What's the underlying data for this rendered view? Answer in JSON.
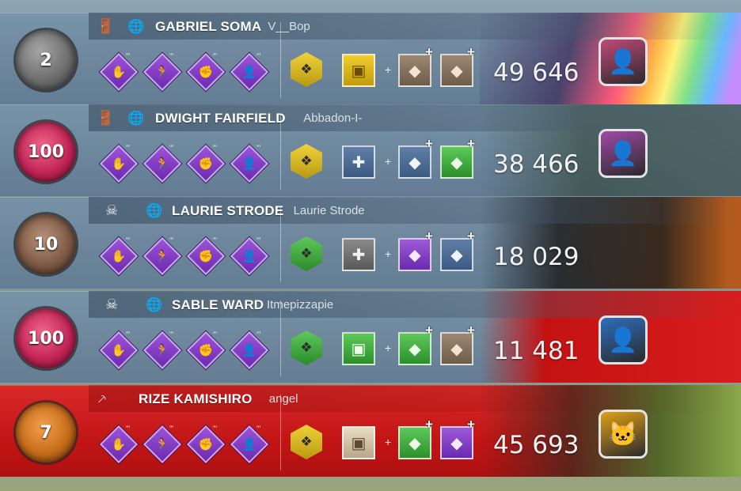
{
  "players": [
    {
      "rank": "2",
      "rank_style": "grey",
      "role": "survivor",
      "role_icon": "exit-icon",
      "name": "GABRIEL SOMA",
      "username": "V__Bop",
      "perks": [
        "perk-1-icon",
        "perk-2-icon",
        "perk-3-icon",
        "perk-4-icon"
      ],
      "offering_color": "yellow",
      "item_color": "yellow",
      "addon_colors": [
        "brown",
        "brown"
      ],
      "score": "49 646",
      "portrait_color": "#c04a7a",
      "deco": "rainbow"
    },
    {
      "rank": "100",
      "rank_style": "red",
      "role": "survivor",
      "role_icon": "exit-icon",
      "name": "DWIGHT FAIRFIELD",
      "username": "Abbadon-I-",
      "perks": [
        "eye-perk-icon",
        "perk-2-icon",
        "perk-3-icon",
        "perk-4-icon"
      ],
      "offering_color": "yellow",
      "item_color": "blue",
      "addon_colors": [
        "blue",
        "green"
      ],
      "score": "38 466",
      "portrait_color": "#a14aa6",
      "deco": "rpd"
    },
    {
      "rank": "10",
      "rank_style": "brown",
      "role": "survivor",
      "role_icon": "skull-icon",
      "name": "LAURIE STRODE",
      "username": "Laurie Strode",
      "perks": [
        "perk-1-icon",
        "perk-2-icon",
        "perk-3-icon",
        "perk-4-icon"
      ],
      "offering_color": "green",
      "item_color": "grey",
      "addon_colors": [
        "purple",
        "blue"
      ],
      "score": "18 029",
      "portrait_color": "",
      "deco": "chains"
    },
    {
      "rank": "100",
      "rank_style": "red",
      "role": "survivor",
      "role_icon": "skull-icon",
      "name": "SABLE WARD",
      "username": "Itmepizzapie",
      "perks": [
        "perk-1-icon",
        "perk-2-icon",
        "perk-3-icon",
        "perk-4-icon"
      ],
      "offering_color": "green",
      "item_color": "green",
      "addon_colors": [
        "green",
        "brown"
      ],
      "score": "11 481",
      "portrait_color": "#2d6fbd",
      "deco": "ghostface"
    },
    {
      "rank": "7",
      "rank_style": "orange",
      "role": "killer",
      "role_icon": "killer-mark-icon",
      "name": "RIZE KAMISHIRO",
      "username": "angel",
      "perks": [
        "perk-1-icon",
        "perk-2-icon",
        "perk-3-icon",
        "perk-4-icon"
      ],
      "offering_color": "yellow",
      "item_color": "cream",
      "addon_colors": [
        "green",
        "purple"
      ],
      "score": "45 693",
      "portrait_color": "#e0a018",
      "deco": "cafe"
    }
  ]
}
